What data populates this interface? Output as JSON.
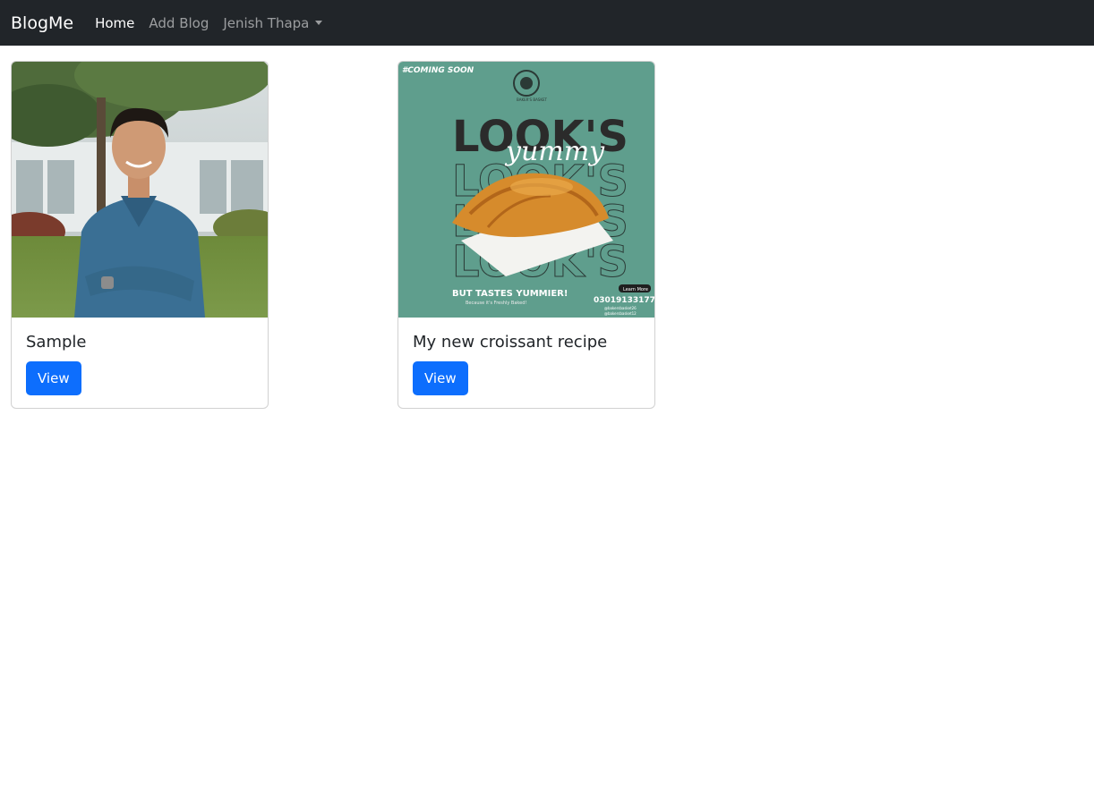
{
  "navbar": {
    "brand": "BlogMe",
    "links": [
      {
        "label": "Home",
        "active": true
      },
      {
        "label": "Add Blog",
        "active": false
      },
      {
        "label": "Jenish Thapa",
        "active": false,
        "dropdown": true
      }
    ]
  },
  "posts": [
    {
      "title": "Sample",
      "button_label": "View",
      "image_icon": "person-photo"
    },
    {
      "title": "My new croissant recipe",
      "button_label": "View",
      "image_icon": "croissant-poster",
      "poster": {
        "tag": "#COMING SOON",
        "logo": "BAKER'S BASKET",
        "headline": "LOOK'S",
        "script": "yummy",
        "tagline": "BUT TASTES YUMMIER!",
        "subline": "Because it's Freshly Baked!",
        "learn_more": "Learn More",
        "phone": "03019133177",
        "handle_1": "@bakersbasket26",
        "handle_2": "@bakersbasket12"
      }
    }
  ],
  "colors": {
    "navbar": "#212529",
    "button": "#0d6efd",
    "poster_bg": "#5f9e8d"
  }
}
